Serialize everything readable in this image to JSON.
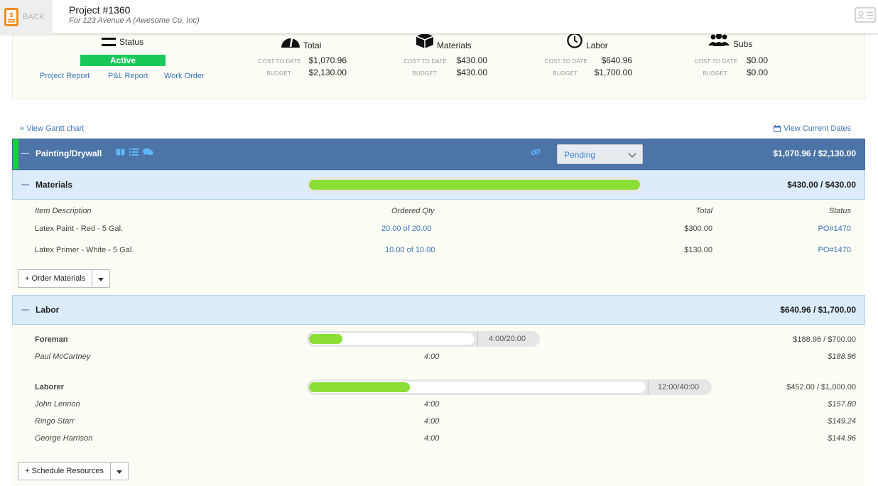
{
  "header": {
    "back_label": "BACK",
    "project_title": "Project #1360",
    "project_subtitle": "For 123 Avenue A (Awesome Co, Inc)"
  },
  "summary": {
    "status_label": "Status",
    "status_value": "Active",
    "links": [
      "Project Report",
      "P&L Report",
      "Work Order"
    ],
    "metrics": [
      {
        "name": "Total",
        "icon": "gauge-icon",
        "cost_label": "COST TO DATE",
        "cost": "$1,070.96",
        "budget_label": "BUDGET",
        "budget": "$2,130.00"
      },
      {
        "name": "Materials",
        "icon": "box-icon",
        "cost_label": "COST TO DATE",
        "cost": "$430.00",
        "budget_label": "BUDGET",
        "budget": "$430.00"
      },
      {
        "name": "Labor",
        "icon": "clock-icon",
        "cost_label": "COST TO DATE",
        "cost": "$640.96",
        "budget_label": "BUDGET",
        "budget": "$1,700.00"
      },
      {
        "name": "Subs",
        "icon": "group-icon",
        "cost_label": "COST TO DATE",
        "cost": "$0.00",
        "budget_label": "BUDGET",
        "budget": "$0.00"
      }
    ]
  },
  "view_gantt": "View Gantt chart",
  "view_dates": "View Current Dates",
  "phase": {
    "title": "Painting/Drywall",
    "status_select": "Pending",
    "total": "$1,070.96 / $2,130.00",
    "accent_color": "#18d23a",
    "header_color": "#4c74a6"
  },
  "materials": {
    "title": "Materials",
    "total": "$430.00 / $430.00",
    "progress_fraction": 1.0,
    "columns": [
      "Item Description",
      "Ordered Qty",
      "Total",
      "Status"
    ],
    "rows": [
      {
        "desc": "Latex Paint - Red - 5 Gal.",
        "qty": "20.00 of 20.00",
        "total": "$300.00",
        "status": "PO#1470"
      },
      {
        "desc": "Latex Primer - White - 5 Gal.",
        "qty": "10.00 of 10.00",
        "total": "$130.00",
        "status": "PO#1470"
      }
    ],
    "order_button": "+ Order Materials"
  },
  "labor": {
    "title": "Labor",
    "total": "$640.96 / $1,700.00",
    "groups": [
      {
        "role": "Foreman",
        "hours": "4:00/20:00",
        "progress_fraction": 0.2,
        "amount": "$188.96 / $700.00",
        "people": [
          {
            "name": "Paul McCartney",
            "hours": "4:00",
            "amount": "$188.96"
          }
        ]
      },
      {
        "role": "Laborer",
        "hours": "12:00/40:00",
        "progress_fraction": 0.3,
        "amount": "$452.00 / $1,000.00",
        "people": [
          {
            "name": "John Lennon",
            "hours": "4:00",
            "amount": "$157.80"
          },
          {
            "name": "Ringo Starr",
            "hours": "4:00",
            "amount": "$149.24"
          },
          {
            "name": "George Harrison",
            "hours": "4:00",
            "amount": "$144.96"
          }
        ]
      }
    ],
    "schedule_button": "+ Schedule Resources"
  },
  "colors": {
    "link_blue": "#3d74b8",
    "progress_green": "#8ade35",
    "status_green": "#1ac85a"
  }
}
